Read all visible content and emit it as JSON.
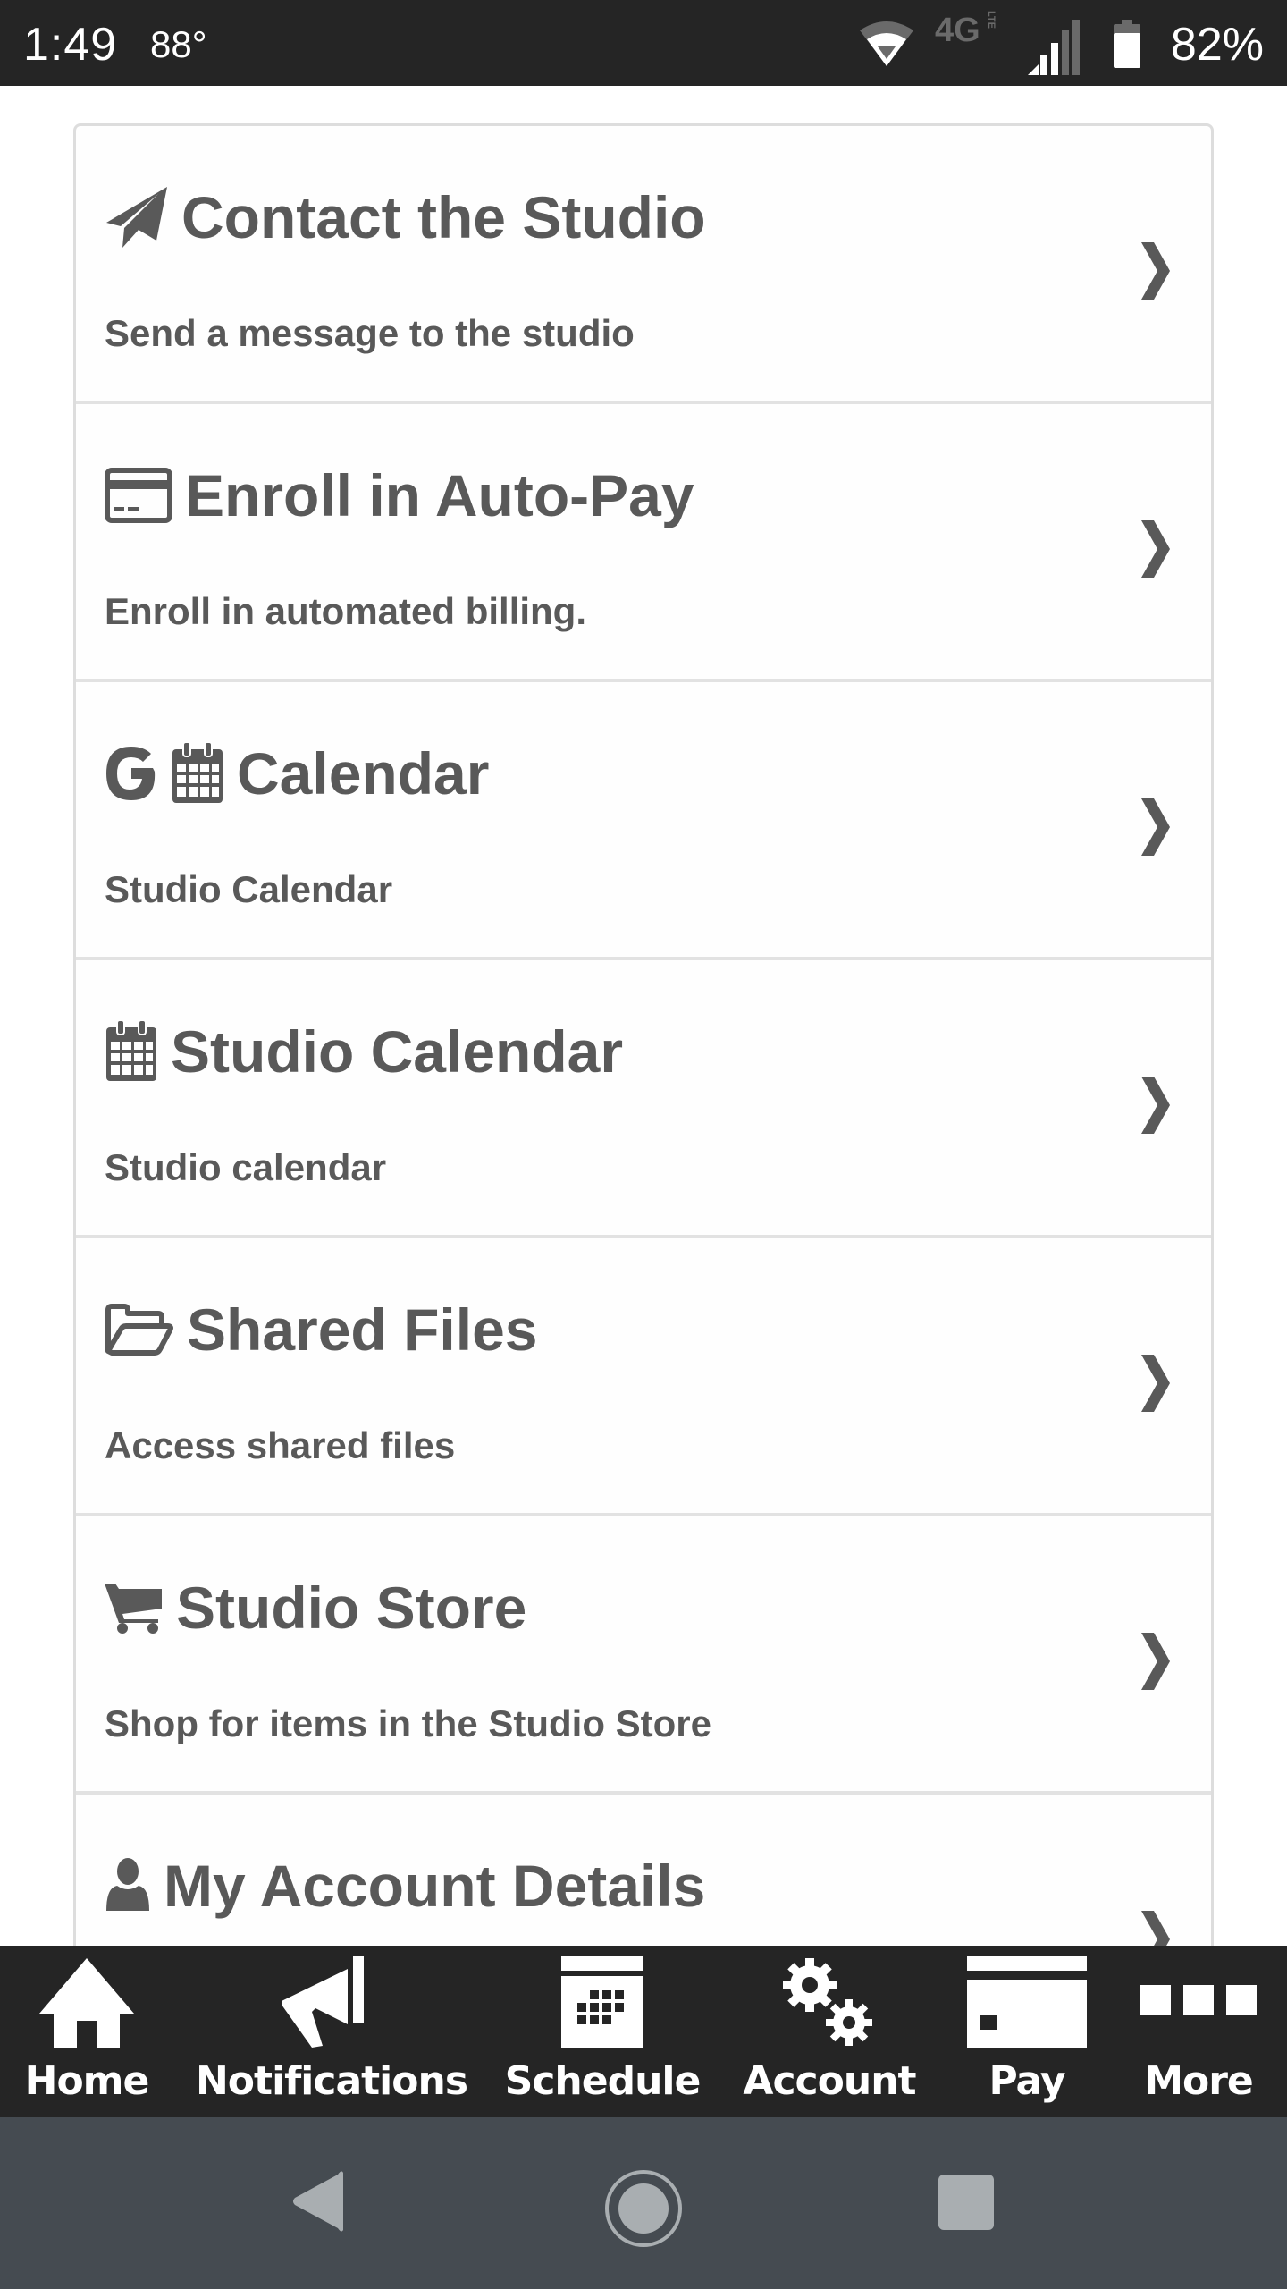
{
  "status_bar": {
    "time": "1:49",
    "temperature": "88°",
    "network_type": "4G LTE",
    "battery_percent": "82%",
    "icons": [
      "wifi-icon",
      "lte-icon",
      "signal-icon",
      "battery-icon"
    ]
  },
  "menu": {
    "items": [
      {
        "icon": "paper-plane-icon",
        "title": "Contact the Studio",
        "description": "Send a message to the studio"
      },
      {
        "icon": "credit-card-icon",
        "title": "Enroll in Auto-Pay",
        "description": "Enroll in automated billing."
      },
      {
        "icon": "google-calendar-icon",
        "title": "Calendar",
        "description": "Studio Calendar"
      },
      {
        "icon": "calendar-icon",
        "title": "Studio Calendar",
        "description": "Studio calendar"
      },
      {
        "icon": "folder-open-icon",
        "title": "Shared Files",
        "description": "Access shared files"
      },
      {
        "icon": "shopping-cart-icon",
        "title": "Studio Store",
        "description": "Shop for items in the Studio Store"
      },
      {
        "icon": "user-icon",
        "title": "My Account Details",
        "description": ""
      }
    ],
    "chevron_icon": "chevron-right-icon"
  },
  "tab_bar": {
    "tabs": [
      {
        "icon": "home-icon",
        "label": "Home"
      },
      {
        "icon": "megaphone-icon",
        "label": "Notifications"
      },
      {
        "icon": "schedule-calendar-icon",
        "label": "Schedule"
      },
      {
        "icon": "gears-icon",
        "label": "Account"
      },
      {
        "icon": "payment-card-icon",
        "label": "Pay"
      },
      {
        "icon": "more-dots-icon",
        "label": "More"
      }
    ]
  },
  "nav_bar": {
    "buttons": [
      "back-icon",
      "home-circle-icon",
      "recents-icon"
    ]
  },
  "colors": {
    "text": "#595959",
    "status_bar_bg": "#252525",
    "tab_bar_bg": "#252525",
    "nav_bar_bg": "#454b51",
    "divider": "#e2e2e2"
  }
}
